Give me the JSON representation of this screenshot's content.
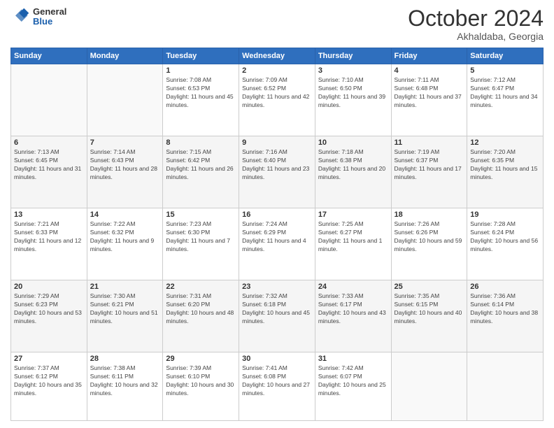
{
  "header": {
    "logo": {
      "general": "General",
      "blue": "Blue"
    },
    "title": "October 2024",
    "location": "Akhaldaba, Georgia"
  },
  "weekdays": [
    "Sunday",
    "Monday",
    "Tuesday",
    "Wednesday",
    "Thursday",
    "Friday",
    "Saturday"
  ],
  "weeks": [
    [
      {
        "day": "",
        "info": ""
      },
      {
        "day": "",
        "info": ""
      },
      {
        "day": "1",
        "info": "Sunrise: 7:08 AM\nSunset: 6:53 PM\nDaylight: 11 hours and 45 minutes."
      },
      {
        "day": "2",
        "info": "Sunrise: 7:09 AM\nSunset: 6:52 PM\nDaylight: 11 hours and 42 minutes."
      },
      {
        "day": "3",
        "info": "Sunrise: 7:10 AM\nSunset: 6:50 PM\nDaylight: 11 hours and 39 minutes."
      },
      {
        "day": "4",
        "info": "Sunrise: 7:11 AM\nSunset: 6:48 PM\nDaylight: 11 hours and 37 minutes."
      },
      {
        "day": "5",
        "info": "Sunrise: 7:12 AM\nSunset: 6:47 PM\nDaylight: 11 hours and 34 minutes."
      }
    ],
    [
      {
        "day": "6",
        "info": "Sunrise: 7:13 AM\nSunset: 6:45 PM\nDaylight: 11 hours and 31 minutes."
      },
      {
        "day": "7",
        "info": "Sunrise: 7:14 AM\nSunset: 6:43 PM\nDaylight: 11 hours and 28 minutes."
      },
      {
        "day": "8",
        "info": "Sunrise: 7:15 AM\nSunset: 6:42 PM\nDaylight: 11 hours and 26 minutes."
      },
      {
        "day": "9",
        "info": "Sunrise: 7:16 AM\nSunset: 6:40 PM\nDaylight: 11 hours and 23 minutes."
      },
      {
        "day": "10",
        "info": "Sunrise: 7:18 AM\nSunset: 6:38 PM\nDaylight: 11 hours and 20 minutes."
      },
      {
        "day": "11",
        "info": "Sunrise: 7:19 AM\nSunset: 6:37 PM\nDaylight: 11 hours and 17 minutes."
      },
      {
        "day": "12",
        "info": "Sunrise: 7:20 AM\nSunset: 6:35 PM\nDaylight: 11 hours and 15 minutes."
      }
    ],
    [
      {
        "day": "13",
        "info": "Sunrise: 7:21 AM\nSunset: 6:33 PM\nDaylight: 11 hours and 12 minutes."
      },
      {
        "day": "14",
        "info": "Sunrise: 7:22 AM\nSunset: 6:32 PM\nDaylight: 11 hours and 9 minutes."
      },
      {
        "day": "15",
        "info": "Sunrise: 7:23 AM\nSunset: 6:30 PM\nDaylight: 11 hours and 7 minutes."
      },
      {
        "day": "16",
        "info": "Sunrise: 7:24 AM\nSunset: 6:29 PM\nDaylight: 11 hours and 4 minutes."
      },
      {
        "day": "17",
        "info": "Sunrise: 7:25 AM\nSunset: 6:27 PM\nDaylight: 11 hours and 1 minute."
      },
      {
        "day": "18",
        "info": "Sunrise: 7:26 AM\nSunset: 6:26 PM\nDaylight: 10 hours and 59 minutes."
      },
      {
        "day": "19",
        "info": "Sunrise: 7:28 AM\nSunset: 6:24 PM\nDaylight: 10 hours and 56 minutes."
      }
    ],
    [
      {
        "day": "20",
        "info": "Sunrise: 7:29 AM\nSunset: 6:23 PM\nDaylight: 10 hours and 53 minutes."
      },
      {
        "day": "21",
        "info": "Sunrise: 7:30 AM\nSunset: 6:21 PM\nDaylight: 10 hours and 51 minutes."
      },
      {
        "day": "22",
        "info": "Sunrise: 7:31 AM\nSunset: 6:20 PM\nDaylight: 10 hours and 48 minutes."
      },
      {
        "day": "23",
        "info": "Sunrise: 7:32 AM\nSunset: 6:18 PM\nDaylight: 10 hours and 45 minutes."
      },
      {
        "day": "24",
        "info": "Sunrise: 7:33 AM\nSunset: 6:17 PM\nDaylight: 10 hours and 43 minutes."
      },
      {
        "day": "25",
        "info": "Sunrise: 7:35 AM\nSunset: 6:15 PM\nDaylight: 10 hours and 40 minutes."
      },
      {
        "day": "26",
        "info": "Sunrise: 7:36 AM\nSunset: 6:14 PM\nDaylight: 10 hours and 38 minutes."
      }
    ],
    [
      {
        "day": "27",
        "info": "Sunrise: 7:37 AM\nSunset: 6:12 PM\nDaylight: 10 hours and 35 minutes."
      },
      {
        "day": "28",
        "info": "Sunrise: 7:38 AM\nSunset: 6:11 PM\nDaylight: 10 hours and 32 minutes."
      },
      {
        "day": "29",
        "info": "Sunrise: 7:39 AM\nSunset: 6:10 PM\nDaylight: 10 hours and 30 minutes."
      },
      {
        "day": "30",
        "info": "Sunrise: 7:41 AM\nSunset: 6:08 PM\nDaylight: 10 hours and 27 minutes."
      },
      {
        "day": "31",
        "info": "Sunrise: 7:42 AM\nSunset: 6:07 PM\nDaylight: 10 hours and 25 minutes."
      },
      {
        "day": "",
        "info": ""
      },
      {
        "day": "",
        "info": ""
      }
    ]
  ]
}
